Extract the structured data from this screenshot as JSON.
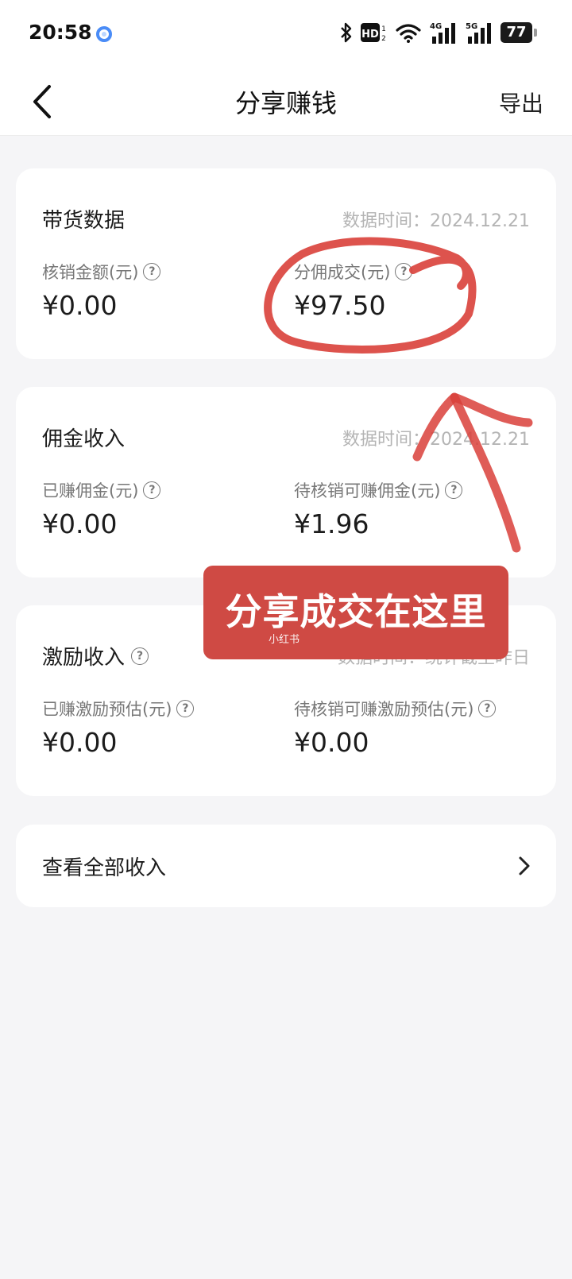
{
  "status_bar": {
    "time": "20:58",
    "battery": "77"
  },
  "nav": {
    "title": "分享赚钱",
    "export_label": "导出"
  },
  "cards": {
    "goods": {
      "title": "带货数据",
      "time": "数据时间：2024.12.21",
      "left_label": "核销金额(元)",
      "left_value": "¥0.00",
      "right_label": "分佣成交(元)",
      "right_value": "¥97.50"
    },
    "commission": {
      "title": "佣金收入",
      "time": "数据时间：2024.12.21",
      "left_label": "已赚佣金(元)",
      "left_value": "¥0.00",
      "right_label": "待核销可赚佣金(元)",
      "right_value": "¥1.96"
    },
    "incentive": {
      "title": "激励收入",
      "time": "数据时间：统计截至昨日",
      "left_label": "已赚激励预估(元)",
      "left_value": "¥0.00",
      "right_label": "待核销可赚激励预估(元)",
      "right_value": "¥0.00"
    }
  },
  "all_income_label": "查看全部收入",
  "help_glyph": "?",
  "annotation": {
    "banner_text": "分享成交在这里",
    "watermark": "小红书",
    "ink_color": "#d9403a"
  }
}
